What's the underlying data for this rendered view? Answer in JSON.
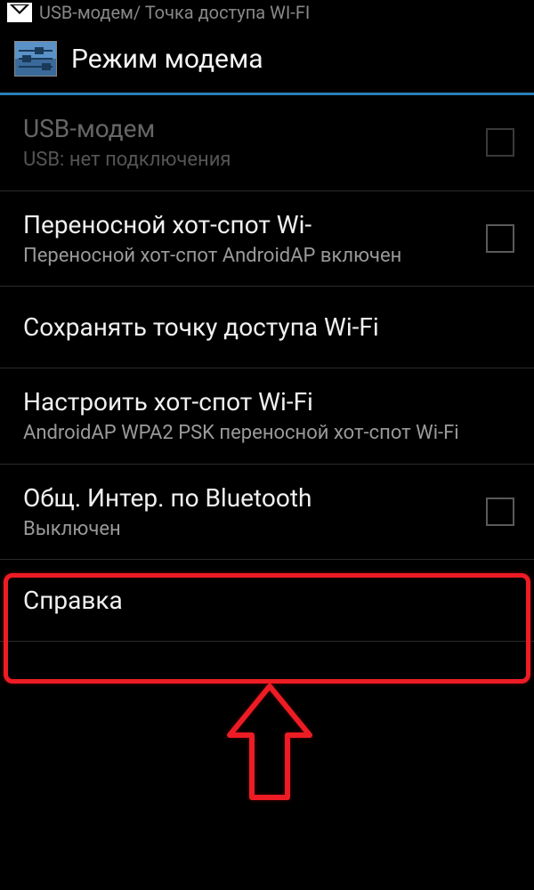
{
  "status_bar": {
    "partial_text": "USB-модем/ Точка доступа WI-FI"
  },
  "header": {
    "title": "Режим модема"
  },
  "items": [
    {
      "title": "USB-модем",
      "subtitle": "USB: нет подключения",
      "disabled": true,
      "has_checkbox": true
    },
    {
      "title": "Переносной хот-спот Wi-",
      "subtitle": "Переносной хот-спот AndroidAP включен",
      "disabled": false,
      "has_checkbox": true
    },
    {
      "title": "Сохранять точку доступа Wi-Fi",
      "subtitle": "",
      "disabled": false,
      "has_checkbox": false
    },
    {
      "title": "Настроить хот-спот Wi-Fi",
      "subtitle": "AndroidAP WPA2 PSK переносной хот-спот Wi-Fi",
      "disabled": false,
      "has_checkbox": false
    },
    {
      "title": "Общ. Интер. по Bluetooth",
      "subtitle": "Выключен",
      "disabled": false,
      "has_checkbox": true
    },
    {
      "title": "Справка",
      "subtitle": "",
      "disabled": false,
      "has_checkbox": false
    }
  ],
  "annotation": {
    "highlight_color": "#ed1c24"
  }
}
